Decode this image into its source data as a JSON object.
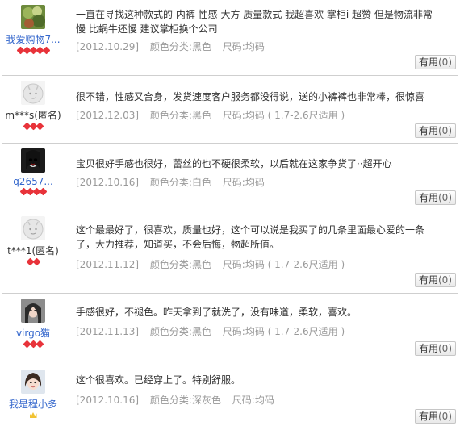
{
  "reviews": [
    {
      "username": "我爱购物7...",
      "anonymous": false,
      "avatar": "leaf-photo-avatar",
      "rank_icons": [
        "gem",
        "gem",
        "gem",
        "gem",
        "gem"
      ],
      "content": "一直在寻找这种款式的 内裤 性感 大方 质量款式 我超喜欢 掌柜i 超赞 但是物流非常慢 比蜗牛还慢 建议掌柜换个公司",
      "date": "[2012.10.29]",
      "color": "颜色分类:黑色",
      "size": "尺码:均码",
      "helpful_label": "有用",
      "helpful_count": "(0)"
    },
    {
      "username": "m***s(匿名)",
      "anonymous": true,
      "avatar": "default-avatar",
      "rank_icons": [
        "gem",
        "gem",
        "gem"
      ],
      "content": "很不错，性感又合身，发货速度客户服务都没得说，送的小裤裤也非常棒，很惊喜",
      "date": "[2012.12.03]",
      "color": "颜色分类:黑色",
      "size": "尺码:均码 ( 1.7-2.6尺适用 )",
      "helpful_label": "有用",
      "helpful_count": "(0)"
    },
    {
      "username": "q2657...",
      "anonymous": false,
      "avatar": "dark-photo-avatar",
      "rank_icons": [
        "gem",
        "gem",
        "gem",
        "gem"
      ],
      "content": "宝贝很好手感也很好，蕾丝的也不硬很柔软，以后就在这家争货了··超开心",
      "date": "[2012.10.16]",
      "color": "颜色分类:白色",
      "size": "尺码:均码",
      "helpful_label": "有用",
      "helpful_count": "(0)"
    },
    {
      "username": "t***1(匿名)",
      "anonymous": true,
      "avatar": "default-avatar",
      "rank_icons": [
        "gem",
        "gem"
      ],
      "content": "这个最最好了，很喜欢，质量也好，这个可以说是我买了的几条里面最心爱的一条了，大力推荐，知道买，不会后悔，物超所值。",
      "date": "[2012.11.12]",
      "color": "颜色分类:黑色",
      "size": "尺码:均码 ( 1.7-2.6尺适用 )",
      "helpful_label": "有用",
      "helpful_count": "(0)"
    },
    {
      "username": "virgo猫",
      "anonymous": false,
      "avatar": "girl-photo-avatar",
      "rank_icons": [
        "gem",
        "gem",
        "gem"
      ],
      "content": "手感很好，不褪色。昨天拿到了就洗了，没有味道，柔软，喜欢。",
      "date": "[2012.11.13]",
      "color": "颜色分类:黑色",
      "size": "尺码:均码 ( 1.7-2.6尺适用 )",
      "helpful_label": "有用",
      "helpful_count": "(0)"
    },
    {
      "username": "我是程小多",
      "anonymous": false,
      "avatar": "girl-photo-avatar-2",
      "rank_icons": [
        "crown"
      ],
      "content": "这个很喜欢。已经穿上了。特别舒服。",
      "date": "[2012.10.16]",
      "color": "颜色分类:深灰色",
      "size": "尺码:均码",
      "helpful_label": "有用",
      "helpful_count": "(0)"
    }
  ]
}
